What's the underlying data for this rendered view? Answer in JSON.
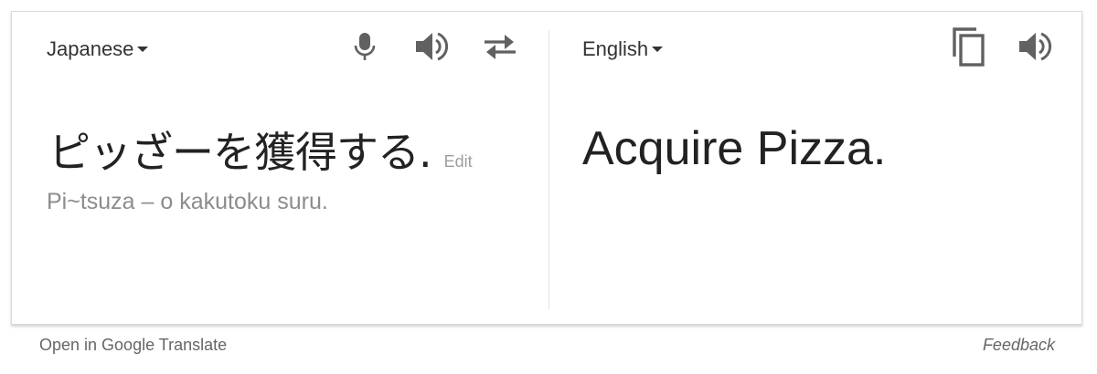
{
  "source": {
    "language": "Japanese",
    "text": "ピッざーを獲得する.",
    "edit_label": "Edit",
    "romanization": "Pi~tsuza ‒ o kakutoku suru."
  },
  "target": {
    "language": "English",
    "text": "Acquire Pizza."
  },
  "icons": {
    "mic": "microphone-icon",
    "source_speaker": "speaker-icon",
    "swap": "swap-languages-icon",
    "copy": "copy-icon",
    "target_speaker": "speaker-icon"
  },
  "colors": {
    "icon": "#616161",
    "text": "#222222",
    "muted": "#8c8c8c"
  },
  "footer": {
    "open_link": "Open in Google Translate",
    "feedback_link": "Feedback"
  }
}
